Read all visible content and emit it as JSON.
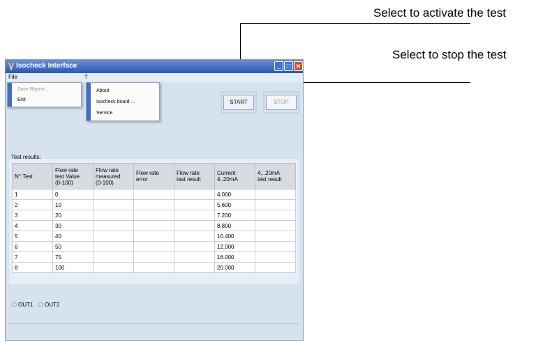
{
  "callouts": {
    "activate": "Select to activate the test",
    "stop": "Select to stop the test"
  },
  "window": {
    "title": "Isocheck Interface"
  },
  "menu": {
    "file": "File",
    "help": "?",
    "file_items": [
      "Save Report ...",
      "Exit"
    ],
    "help_items": [
      "About",
      "Isocheck board ...",
      "Service"
    ]
  },
  "buttons": {
    "start": "START",
    "stop": "STOP"
  },
  "test_results_label": "Test results:",
  "table": {
    "headers": [
      [
        "N°.Test"
      ],
      [
        "Flow rate",
        "test Value",
        "(0-100)"
      ],
      [
        "Flow rate",
        "measured",
        "(0-100)"
      ],
      [
        "Flow rate",
        "error"
      ],
      [
        "Flow rate",
        "test result"
      ],
      [
        "Current",
        "4..20mA"
      ],
      [
        "4...20mA",
        "test result"
      ]
    ],
    "rows": [
      [
        "1",
        "0",
        "",
        "",
        "",
        "4.000",
        ""
      ],
      [
        "2",
        "10",
        "",
        "",
        "",
        "5.600",
        ""
      ],
      [
        "3",
        "20",
        "",
        "",
        "",
        "7.200",
        ""
      ],
      [
        "4",
        "30",
        "",
        "",
        "",
        "8.800",
        ""
      ],
      [
        "5",
        "40",
        "",
        "",
        "",
        "10.400",
        ""
      ],
      [
        "6",
        "50",
        "",
        "",
        "",
        "12.000",
        ""
      ],
      [
        "7",
        "75",
        "",
        "",
        "",
        "16.000",
        ""
      ],
      [
        "8",
        "100",
        "",
        "",
        "",
        "20.000",
        ""
      ]
    ]
  },
  "outputs": [
    "OUT1",
    "OUT2"
  ]
}
